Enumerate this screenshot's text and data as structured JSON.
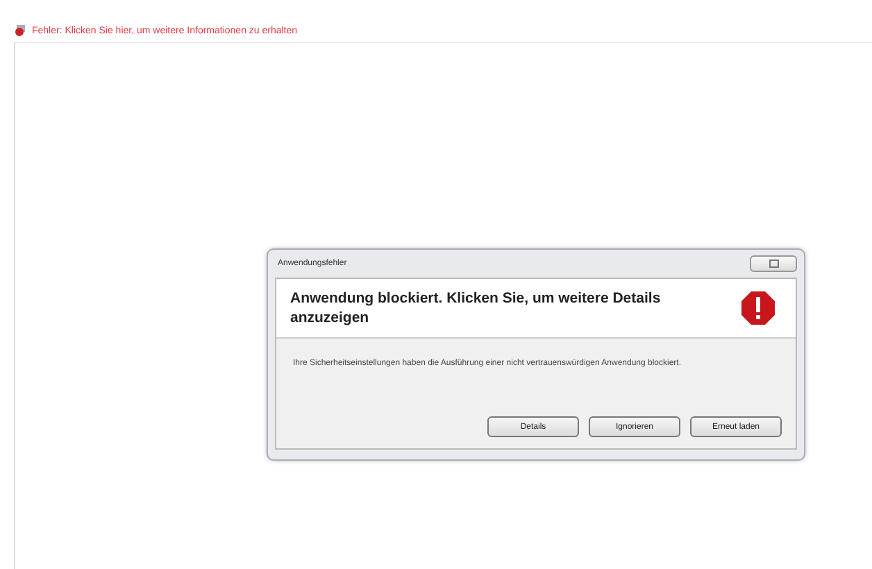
{
  "notification_bar": {
    "text": "Fehler: Klicken Sie hier, um weitere Informationen zu erhalten"
  },
  "dialog": {
    "title": "Anwendungsfehler",
    "heading": "Anwendung blockiert. Klicken Sie, um weitere Details anzuzeigen",
    "message": "Ihre Sicherheitseinstellungen haben die Ausführung einer nicht vertrauenswürdigen Anwendung blockiert.",
    "buttons": [
      "Details",
      "Ignorieren",
      "Erneut laden"
    ]
  }
}
